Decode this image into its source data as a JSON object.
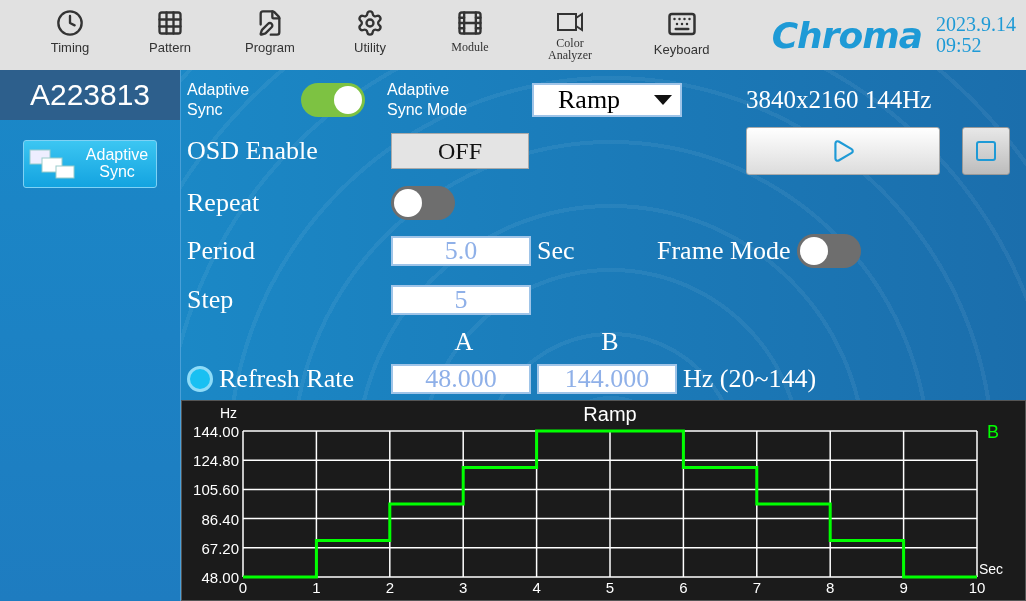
{
  "toolbar": {
    "items": [
      {
        "label": "Timing",
        "kind": "timing"
      },
      {
        "label": "Pattern",
        "kind": "pattern"
      },
      {
        "label": "Program",
        "kind": "program"
      },
      {
        "label": "Utility",
        "kind": "utility"
      },
      {
        "label": "Module",
        "kind": "module"
      },
      {
        "label": "Color\nAnalyzer",
        "kind": "analyzer"
      },
      {
        "label": "Keyboard",
        "kind": "keyboard"
      }
    ],
    "logo": "Chroma",
    "date": "2023.9.14",
    "time": "09:52"
  },
  "sidebar": {
    "title": "A223813",
    "items": [
      {
        "label": "Adaptive\nSync",
        "selected": true
      }
    ]
  },
  "form": {
    "adaptive_sync": {
      "label": "Adaptive\nSync",
      "on": true
    },
    "mode": {
      "label": "Adaptive\nSync Mode",
      "value": "Ramp"
    },
    "resolution": "3840x2160 144Hz",
    "osd": {
      "label": "OSD Enable",
      "value": "OFF"
    },
    "repeat": {
      "label": "Repeat",
      "on": false
    },
    "period": {
      "label": "Period",
      "value": "5.0",
      "unit": "Sec"
    },
    "frame_mode": {
      "label": "Frame Mode",
      "on": false
    },
    "step": {
      "label": "Step",
      "value": "5"
    },
    "headers": [
      "A",
      "B"
    ],
    "refresh_rate": {
      "label": "Refresh Rate",
      "selected": true,
      "a": "48.000",
      "b": "144.000",
      "unit": "Hz (20~144)"
    }
  },
  "chart": {
    "chart_data": {
      "type": "line",
      "title": "Ramp",
      "xlabel": "Sec",
      "ylabel": "Hz",
      "x": [
        0,
        1,
        1,
        2,
        2,
        3,
        3,
        4,
        4,
        6,
        6,
        7,
        7,
        8,
        8,
        9,
        9,
        10
      ],
      "series": [
        {
          "name": "B",
          "color": "#00ff00",
          "values": [
            48,
            48,
            72,
            72,
            96,
            96,
            120,
            120,
            144,
            144,
            120,
            120,
            96,
            96,
            72,
            72,
            48,
            48
          ]
        }
      ],
      "grid": true,
      "xlim": [
        0,
        10
      ],
      "ylim": [
        48,
        144
      ],
      "xticks": [
        0,
        1,
        2,
        3,
        4,
        5,
        6,
        7,
        8,
        9,
        10
      ],
      "yticks": [
        {
          "value": 48,
          "label": "48.00"
        },
        {
          "value": 67.2,
          "label": "67.20"
        },
        {
          "value": 86.4,
          "label": "86.40"
        },
        {
          "value": 105.6,
          "label": "105.60"
        },
        {
          "value": 124.8,
          "label": "124.80"
        },
        {
          "value": 144,
          "label": "144.00"
        }
      ]
    }
  }
}
